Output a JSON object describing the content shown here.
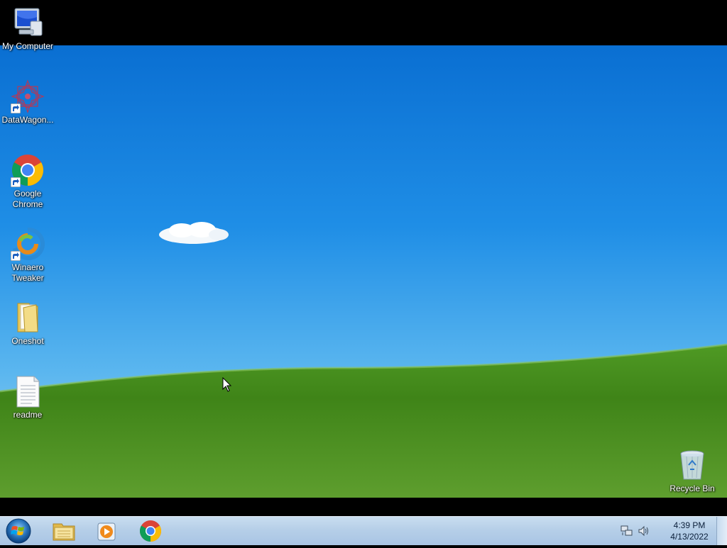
{
  "desktop": {
    "icons": [
      {
        "label": "My Computer",
        "icon": "computer-icon"
      },
      {
        "label": "DataWagon...",
        "icon": "datawagon-icon"
      },
      {
        "label": "Google\nChrome",
        "icon": "chrome-icon"
      },
      {
        "label": "Winaero\nTweaker",
        "icon": "winaero-icon"
      },
      {
        "label": "Oneshot",
        "icon": "folder-icon"
      },
      {
        "label": "readme",
        "icon": "text-file-icon"
      },
      {
        "label": "Recycle Bin",
        "icon": "recycle-bin-icon"
      }
    ]
  },
  "taskbar": {
    "start_icon": "windows-start-icon",
    "pinned": [
      "file-explorer-icon",
      "media-player-icon",
      "chrome-icon"
    ],
    "tray_icons": [
      "network-icon",
      "volume-icon"
    ],
    "clock": {
      "time": "4:39 PM",
      "date": "4/13/2022"
    }
  },
  "colors": {
    "sky": "#1f8ee6",
    "grass": "#4f8f1f",
    "taskbar": "#b6cfe8"
  }
}
